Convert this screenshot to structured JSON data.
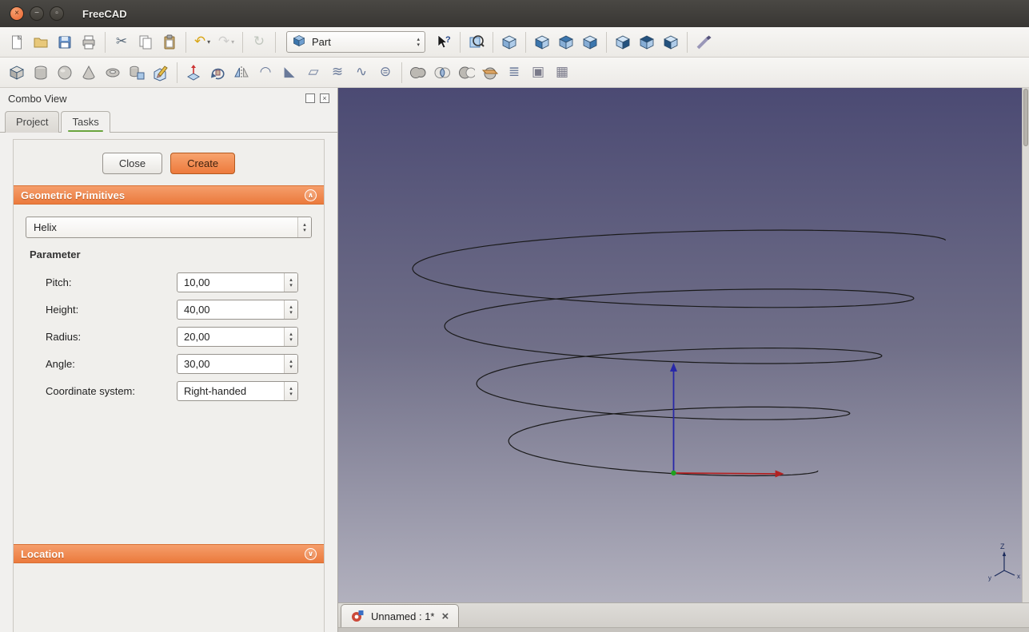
{
  "titlebar": {
    "title": "FreeCAD"
  },
  "window_buttons": {
    "close": "×",
    "minimize": "−",
    "maximize": "▫"
  },
  "icons": {
    "dropdown_glyph": "▾",
    "spin_up": "▴",
    "spin_down": "▾",
    "chevron_up": "∧",
    "chevron_down": "∨",
    "close_glyph": "×"
  },
  "workbench_combo": {
    "value": "Part"
  },
  "toolbar_main": {
    "items": [
      {
        "name": "new-document-button",
        "icon": "new-document-icon",
        "shape": "page"
      },
      {
        "name": "open-document-button",
        "icon": "open-folder-icon",
        "shape": "folder"
      },
      {
        "name": "save-button",
        "icon": "save-icon",
        "shape": "save"
      },
      {
        "name": "print-button",
        "icon": "print-icon",
        "shape": "printer"
      },
      {
        "sep": true
      },
      {
        "name": "cut-button",
        "icon": "scissors-icon",
        "glyph": "✂",
        "color": "#5a6a7a"
      },
      {
        "name": "copy-button",
        "icon": "copy-icon",
        "shape": "copy"
      },
      {
        "name": "paste-button",
        "icon": "paste-icon",
        "shape": "paste"
      },
      {
        "sep": true
      },
      {
        "name": "undo-button",
        "icon": "undo-icon",
        "glyph": "↶",
        "color": "#d9a514",
        "dropdown": true
      },
      {
        "name": "redo-button",
        "icon": "redo-icon",
        "glyph": "↷",
        "color": "#9a9a9a",
        "dropdown": true,
        "disabled": true
      },
      {
        "sep": true
      },
      {
        "name": "refresh-button",
        "icon": "refresh-icon",
        "glyph": "↻",
        "color": "#7a8a7a",
        "disabled": true
      },
      {
        "sep": true
      },
      {
        "widget": "workbench-combo"
      },
      {
        "name": "whats-this-button",
        "icon": "help-cursor-icon",
        "shape": "whatsthis"
      },
      {
        "sep": true
      },
      {
        "name": "fit-all-button",
        "icon": "fit-all-icon",
        "shape": "fit"
      },
      {
        "sep": true
      },
      {
        "name": "axonometric-view-button",
        "icon": "axonometric-cube-icon",
        "shape": "cube",
        "faces": {
          "top": "#d3e5f6",
          "left": "#86add5",
          "right": "#aecbe8"
        }
      },
      {
        "sep": true
      },
      {
        "name": "front-view-button",
        "icon": "front-view-cube-icon",
        "shape": "cube",
        "faces": {
          "top": "#d3e5f6",
          "left": "#3c76ad",
          "right": "#aecbe8"
        }
      },
      {
        "name": "top-view-button",
        "icon": "top-view-cube-icon",
        "shape": "cube",
        "faces": {
          "top": "#3c76ad",
          "left": "#86add5",
          "right": "#aecbe8"
        }
      },
      {
        "name": "right-view-button",
        "icon": "right-view-cube-icon",
        "shape": "cube",
        "faces": {
          "top": "#d3e5f6",
          "left": "#86add5",
          "right": "#3c76ad"
        }
      },
      {
        "sep": true
      },
      {
        "name": "rear-view-button",
        "icon": "rear-view-cube-icon",
        "shape": "cube",
        "faces": {
          "top": "#d3e5f6",
          "left": "#aecbe8",
          "right": "#24527e"
        }
      },
      {
        "name": "bottom-view-button",
        "icon": "bottom-view-cube-icon",
        "shape": "cube",
        "faces": {
          "top": "#24527e",
          "left": "#86add5",
          "right": "#aecbe8"
        }
      },
      {
        "name": "left-view-button",
        "icon": "left-view-cube-icon",
        "shape": "cube",
        "faces": {
          "top": "#d3e5f6",
          "left": "#24527e",
          "right": "#aecbe8"
        }
      },
      {
        "sep": true
      },
      {
        "name": "measure-distance-button",
        "icon": "measure-icon",
        "shape": "measure"
      }
    ]
  },
  "toolbar_part": {
    "items": [
      {
        "name": "box-button",
        "icon": "box-icon",
        "shape": "cube",
        "faces": {
          "top": "#e4e2dd",
          "left": "#b2afa9",
          "right": "#cdcac4"
        }
      },
      {
        "name": "cylinder-button",
        "icon": "cylinder-icon",
        "shape": "cylinder"
      },
      {
        "name": "sphere-button",
        "icon": "sphere-icon",
        "shape": "sphere"
      },
      {
        "name": "cone-button",
        "icon": "cone-icon",
        "shape": "cone"
      },
      {
        "name": "torus-button",
        "icon": "torus-icon",
        "shape": "torus"
      },
      {
        "name": "create-primitives-button",
        "icon": "primitives-icon",
        "shape": "primitives"
      },
      {
        "name": "shape-builder-button",
        "icon": "shape-builder-icon",
        "shape": "shapebuilder"
      },
      {
        "sep": true
      },
      {
        "name": "extrude-button",
        "icon": "extrude-icon",
        "shape": "extrude"
      },
      {
        "name": "revolve-button",
        "icon": "revolve-icon",
        "shape": "revolve"
      },
      {
        "name": "mirror-button",
        "icon": "mirror-icon",
        "shape": "mirror"
      },
      {
        "name": "fillet-button",
        "icon": "fillet-icon",
        "glyph": "◠",
        "color": "#6a7a9a"
      },
      {
        "name": "chamfer-button",
        "icon": "chamfer-icon",
        "glyph": "◣",
        "color": "#6a7a9a"
      },
      {
        "name": "ruled-surface-button",
        "icon": "ruled-surface-icon",
        "glyph": "▱",
        "color": "#6a7a9a"
      },
      {
        "name": "loft-button",
        "icon": "loft-icon",
        "glyph": "≋",
        "color": "#6a7a9a"
      },
      {
        "name": "sweep-button",
        "icon": "sweep-icon",
        "glyph": "∿",
        "color": "#6a7a9a"
      },
      {
        "name": "offset-button",
        "icon": "offset-icon",
        "glyph": "⊜",
        "color": "#6a7a9a"
      },
      {
        "sep": true
      },
      {
        "name": "boolean-union-button",
        "icon": "union-icon",
        "shape": "union"
      },
      {
        "name": "boolean-common-button",
        "icon": "common-icon",
        "shape": "common"
      },
      {
        "name": "boolean-cut-button",
        "icon": "cut-shape-icon",
        "shape": "cutb"
      },
      {
        "name": "section-button",
        "icon": "section-icon",
        "shape": "section"
      },
      {
        "name": "cross-sections-button",
        "icon": "cross-sections-icon",
        "glyph": "≣",
        "color": "#6a7a9a"
      },
      {
        "name": "compound-button",
        "icon": "compound-icon",
        "glyph": "▣",
        "color": "#7a7a8a"
      },
      {
        "name": "defeaturing-button",
        "icon": "defeaturing-icon",
        "glyph": "▦",
        "color": "#7a7a8a"
      }
    ]
  },
  "combo_view": {
    "title": "Combo View",
    "tabs": {
      "project": "Project",
      "tasks": "Tasks"
    },
    "buttons": {
      "close": "Close",
      "create": "Create"
    },
    "geometric_section": {
      "title": "Geometric Primitives"
    },
    "location_section": {
      "title": "Location"
    },
    "primitive_combo": {
      "value": "Helix"
    },
    "parameter_heading": "Parameter",
    "fields": [
      {
        "label": "Pitch:",
        "value": "10,00"
      },
      {
        "label": "Height:",
        "value": "40,00"
      },
      {
        "label": "Radius:",
        "value": "20,00"
      },
      {
        "label": "Angle:",
        "value": "30,00"
      },
      {
        "label": "Coordinate system:",
        "value": "Right-handed"
      }
    ]
  },
  "document_tab": {
    "label": "Unnamed : 1*"
  },
  "viewport_axes": {
    "z": "Z",
    "y": "y",
    "x": "x"
  },
  "colors": {
    "accent_orange": "#ed7a3c",
    "titlebar": "#3c3b37",
    "viewport_top": "#4b4a73",
    "viewport_bottom": "#b2b1be",
    "axis_x": "#b22222",
    "axis_z": "#2828a8",
    "origin_point": "#1fa11f",
    "helix_curve": "#1a1a1a"
  }
}
